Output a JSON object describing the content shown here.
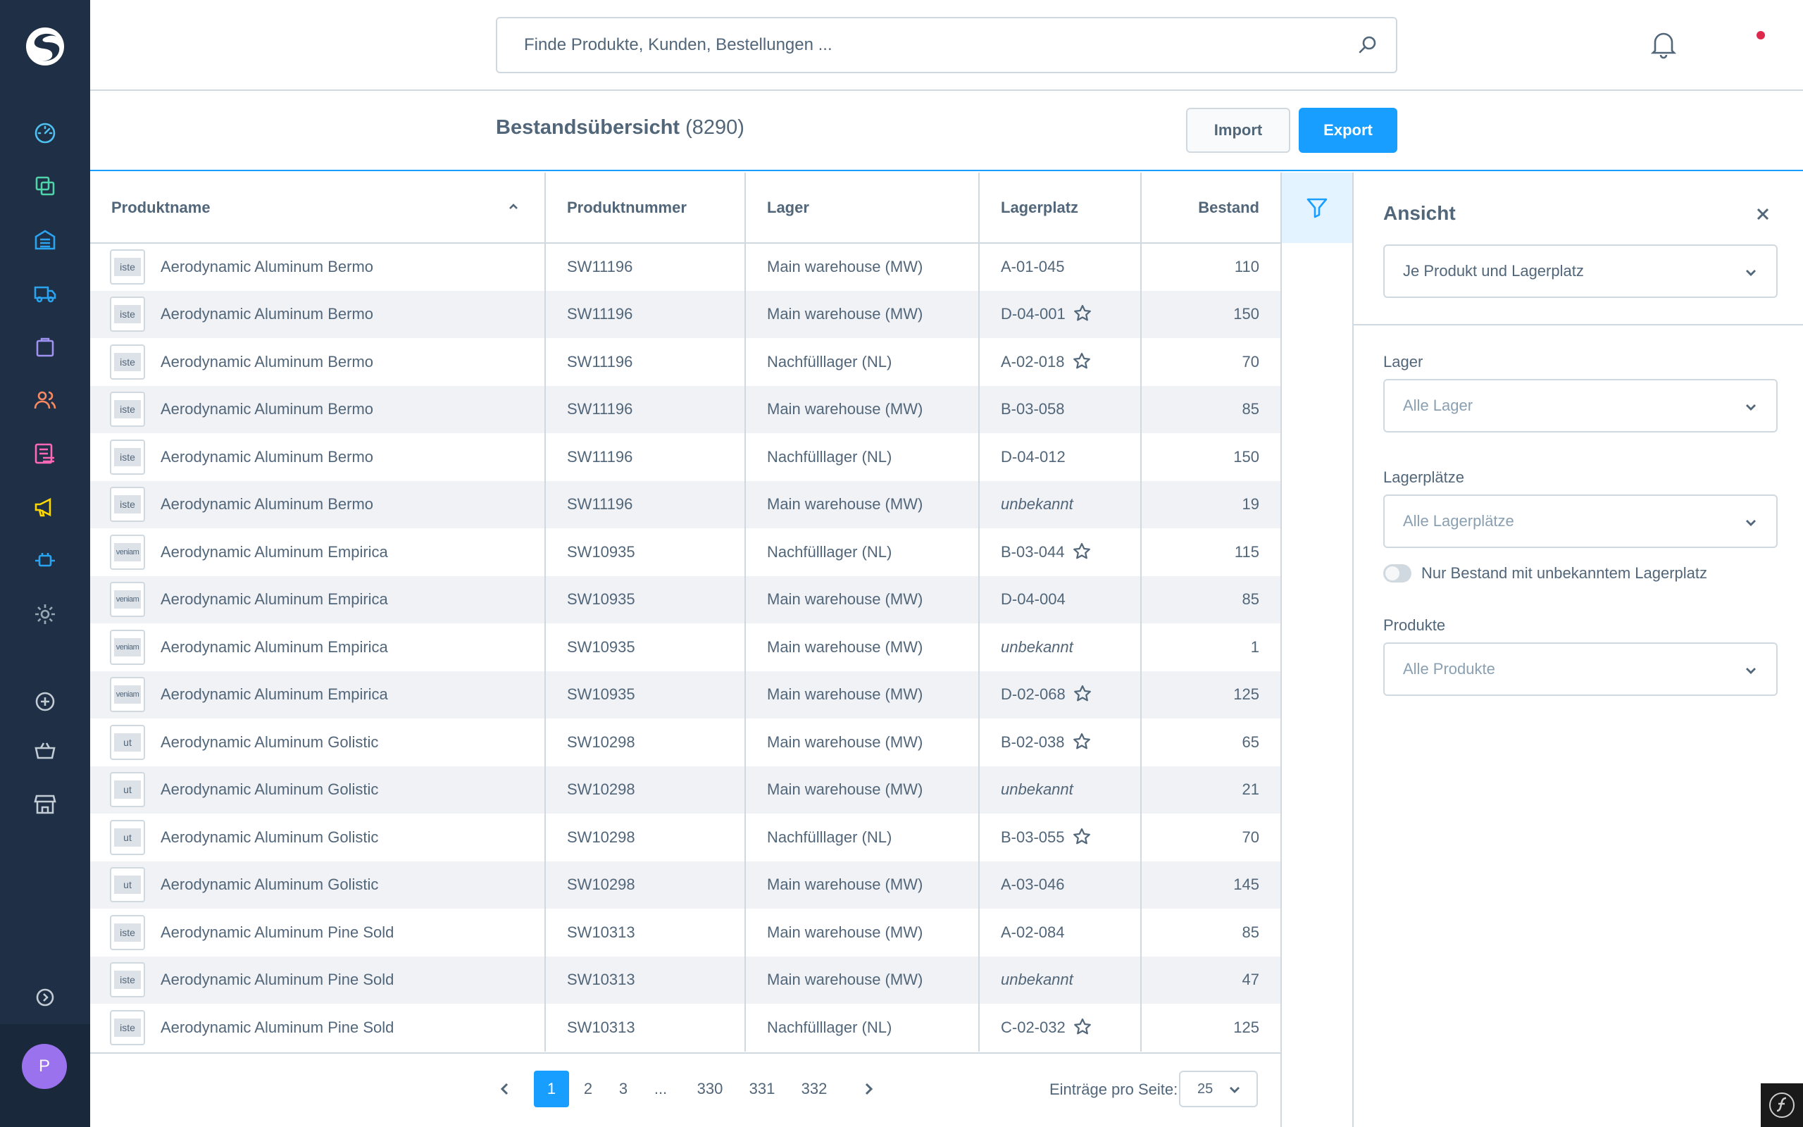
{
  "colors": {
    "sidebar": "#1f2f45",
    "accent": "#189eff",
    "text": "#52667a",
    "border": "#d1d9e0",
    "row_alt": "#f0f2f5",
    "avatar": "#9b72ee",
    "notification_dot": "#de294c"
  },
  "sidebar": {
    "logo": "shopware-logo",
    "items": [
      {
        "icon": "dashboard-icon"
      },
      {
        "icon": "products-icon"
      },
      {
        "icon": "warehouse-icon"
      },
      {
        "icon": "shipping-truck-icon"
      },
      {
        "icon": "orders-bag-icon"
      },
      {
        "icon": "customers-icon"
      },
      {
        "icon": "content-icon"
      },
      {
        "icon": "marketing-megaphone-icon"
      },
      {
        "icon": "extensions-plug-icon"
      },
      {
        "icon": "settings-gear-icon"
      },
      {
        "icon": "add-circle-icon"
      },
      {
        "icon": "basket-icon"
      },
      {
        "icon": "storefront-icon"
      },
      {
        "icon": "expand-sidebar-icon"
      }
    ],
    "user_initial": "P"
  },
  "search": {
    "placeholder": "Finde Produkte, Kunden, Bestellungen ..."
  },
  "header": {
    "title": "Bestandsübersicht",
    "count": "(8290)",
    "import_label": "Import",
    "export_label": "Export"
  },
  "table": {
    "columns": [
      "Produktname",
      "Produktnummer",
      "Lager",
      "Lagerplatz",
      "Bestand"
    ],
    "rows": [
      {
        "thumb": "iste",
        "name": "Aerodynamic Aluminum Bermo",
        "number": "SW11196",
        "warehouse": "Main warehouse (MW)",
        "bin": "A-01-045",
        "default_bin": false,
        "unknown": false,
        "stock": "110"
      },
      {
        "thumb": "iste",
        "name": "Aerodynamic Aluminum Bermo",
        "number": "SW11196",
        "warehouse": "Main warehouse (MW)",
        "bin": "D-04-001",
        "default_bin": true,
        "unknown": false,
        "stock": "150"
      },
      {
        "thumb": "iste",
        "name": "Aerodynamic Aluminum Bermo",
        "number": "SW11196",
        "warehouse": "Nachfülllager (NL)",
        "bin": "A-02-018",
        "default_bin": true,
        "unknown": false,
        "stock": "70"
      },
      {
        "thumb": "iste",
        "name": "Aerodynamic Aluminum Bermo",
        "number": "SW11196",
        "warehouse": "Main warehouse (MW)",
        "bin": "B-03-058",
        "default_bin": false,
        "unknown": false,
        "stock": "85"
      },
      {
        "thumb": "iste",
        "name": "Aerodynamic Aluminum Bermo",
        "number": "SW11196",
        "warehouse": "Nachfülllager (NL)",
        "bin": "D-04-012",
        "default_bin": false,
        "unknown": false,
        "stock": "150"
      },
      {
        "thumb": "iste",
        "name": "Aerodynamic Aluminum Bermo",
        "number": "SW11196",
        "warehouse": "Main warehouse (MW)",
        "bin": "unbekannt",
        "default_bin": false,
        "unknown": true,
        "stock": "19"
      },
      {
        "thumb": "veniam",
        "name": "Aerodynamic Aluminum Empirica",
        "number": "SW10935",
        "warehouse": "Nachfülllager (NL)",
        "bin": "B-03-044",
        "default_bin": true,
        "unknown": false,
        "stock": "115"
      },
      {
        "thumb": "veniam",
        "name": "Aerodynamic Aluminum Empirica",
        "number": "SW10935",
        "warehouse": "Main warehouse (MW)",
        "bin": "D-04-004",
        "default_bin": false,
        "unknown": false,
        "stock": "85"
      },
      {
        "thumb": "veniam",
        "name": "Aerodynamic Aluminum Empirica",
        "number": "SW10935",
        "warehouse": "Main warehouse (MW)",
        "bin": "unbekannt",
        "default_bin": false,
        "unknown": true,
        "stock": "1"
      },
      {
        "thumb": "veniam",
        "name": "Aerodynamic Aluminum Empirica",
        "number": "SW10935",
        "warehouse": "Main warehouse (MW)",
        "bin": "D-02-068",
        "default_bin": true,
        "unknown": false,
        "stock": "125"
      },
      {
        "thumb": "ut",
        "name": "Aerodynamic Aluminum Golistic",
        "number": "SW10298",
        "warehouse": "Main warehouse (MW)",
        "bin": "B-02-038",
        "default_bin": true,
        "unknown": false,
        "stock": "65"
      },
      {
        "thumb": "ut",
        "name": "Aerodynamic Aluminum Golistic",
        "number": "SW10298",
        "warehouse": "Main warehouse (MW)",
        "bin": "unbekannt",
        "default_bin": false,
        "unknown": true,
        "stock": "21"
      },
      {
        "thumb": "ut",
        "name": "Aerodynamic Aluminum Golistic",
        "number": "SW10298",
        "warehouse": "Nachfülllager (NL)",
        "bin": "B-03-055",
        "default_bin": true,
        "unknown": false,
        "stock": "70"
      },
      {
        "thumb": "ut",
        "name": "Aerodynamic Aluminum Golistic",
        "number": "SW10298",
        "warehouse": "Main warehouse (MW)",
        "bin": "A-03-046",
        "default_bin": false,
        "unknown": false,
        "stock": "145"
      },
      {
        "thumb": "iste",
        "name": "Aerodynamic Aluminum Pine Sold",
        "number": "SW10313",
        "warehouse": "Main warehouse (MW)",
        "bin": "A-02-084",
        "default_bin": false,
        "unknown": false,
        "stock": "85"
      },
      {
        "thumb": "iste",
        "name": "Aerodynamic Aluminum Pine Sold",
        "number": "SW10313",
        "warehouse": "Main warehouse (MW)",
        "bin": "unbekannt",
        "default_bin": false,
        "unknown": true,
        "stock": "47"
      },
      {
        "thumb": "iste",
        "name": "Aerodynamic Aluminum Pine Sold",
        "number": "SW10313",
        "warehouse": "Nachfülllager (NL)",
        "bin": "C-02-032",
        "default_bin": true,
        "unknown": false,
        "stock": "125"
      }
    ]
  },
  "pagination": {
    "pages": [
      "1",
      "2",
      "3",
      "...",
      "330",
      "331",
      "332"
    ],
    "current": "1",
    "per_page_label": "Einträge pro Seite:",
    "per_page": "25"
  },
  "panel": {
    "title": "Ansicht",
    "view_value": "Je Produkt und Lagerplatz",
    "warehouse_label": "Lager",
    "warehouse_placeholder": "Alle Lager",
    "bins_label": "Lagerplätze",
    "bins_placeholder": "Alle Lagerplätze",
    "toggle_label": "Nur Bestand mit unbekanntem Lagerplatz",
    "toggle_on": false,
    "products_label": "Produkte",
    "products_placeholder": "Alle Produkte"
  }
}
